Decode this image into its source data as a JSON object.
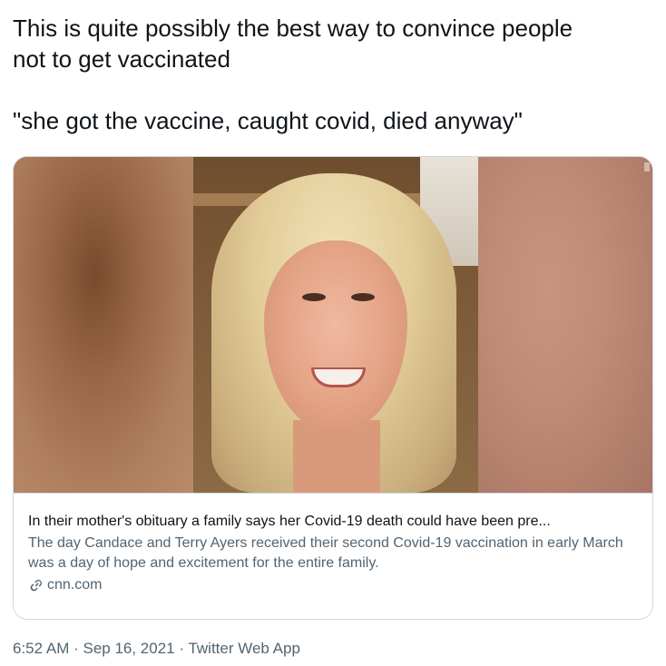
{
  "tweet": {
    "text_line1": "This is quite possibly the best way to convince people",
    "text_line2": "not to get vaccinated",
    "text_line3": "\"she got the vaccine, caught covid, died anyway\""
  },
  "card": {
    "title": "In their mother's obituary a family says her Covid-19 death could have been pre...",
    "description": "The day Candace and Terry Ayers received their second Covid-19 vaccination in early March was a day of hope and excitement for the entire family.",
    "domain": "cnn.com",
    "icon": "link-icon"
  },
  "meta": {
    "time": "6:52 AM",
    "separator": " · ",
    "date": "Sep 16, 2021",
    "source": "Twitter Web App"
  },
  "colors": {
    "text": "#0f1419",
    "secondary": "#536471",
    "border": "#cfd9de"
  }
}
